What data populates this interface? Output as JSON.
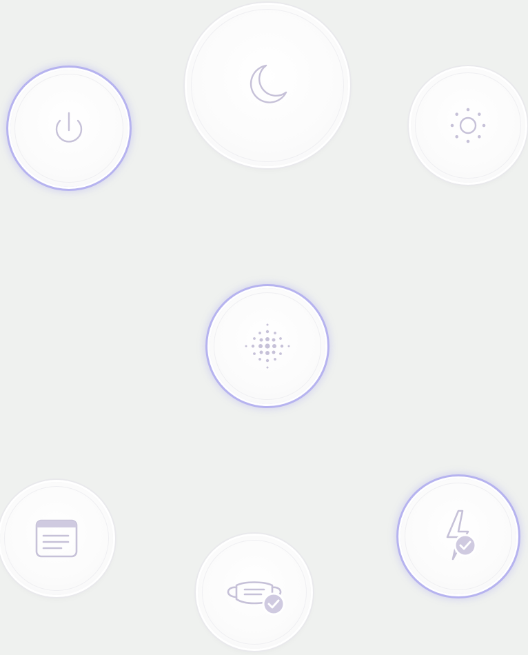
{
  "colors": {
    "background": "#eff1ef",
    "active_ring": "#b6b3ef",
    "icon": "#c6c1d8",
    "icon_fill": "#cfcae0"
  },
  "controls": [
    {
      "id": "power",
      "icon": "power-icon",
      "active": true
    },
    {
      "id": "sleep",
      "icon": "moon-icon",
      "active": false
    },
    {
      "id": "light",
      "icon": "sun-icon",
      "active": false
    },
    {
      "id": "fan",
      "icon": "dot-grid-icon",
      "active": true
    },
    {
      "id": "display",
      "icon": "window-icon",
      "active": false
    },
    {
      "id": "filter",
      "icon": "mask-check-icon",
      "active": false
    },
    {
      "id": "charge",
      "icon": "bolt-check-icon",
      "active": true
    }
  ]
}
